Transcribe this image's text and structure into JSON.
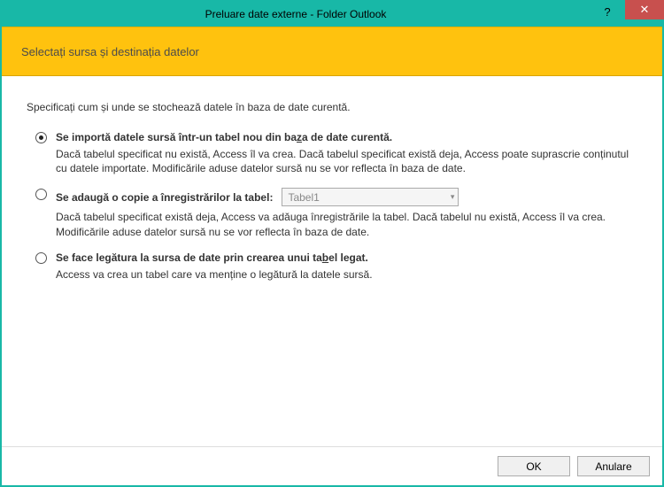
{
  "titlebar": {
    "title": "Preluare date externe - Folder Outlook",
    "help": "?",
    "close": "✕"
  },
  "banner": {
    "heading": "Selectați sursa și destinația datelor"
  },
  "instruction": "Specificați cum și unde se stochează datele în baza de date curentă.",
  "options": {
    "import": {
      "title_pre": "Se importă datele sursă într-un tabel nou din ba",
      "title_u": "z",
      "title_post": "a de date curentă.",
      "desc": "Dacă tabelul specificat nu există, Access îl va crea. Dacă tabelul specificat există deja, Access poate suprascrie conținutul cu datele importate. Modificările aduse datelor sursă nu se vor reflecta în baza de date."
    },
    "append": {
      "title_pre": "Se adau",
      "title_u": "g",
      "title_post": "ă o copie a înregistrărilor la tabel:",
      "combo_value": "Tabel1",
      "desc": "Dacă tabelul specificat există deja, Access va adăuga înregistrările la tabel. Dacă tabelul nu există, Access îl va crea. Modificările aduse datelor sursă nu se vor reflecta în baza de date."
    },
    "link": {
      "title_pre": "Se face legătura la sursa de date prin crearea unui ta",
      "title_u": "b",
      "title_post": "el legat.",
      "desc": "Access va crea un tabel care va menține o legătură la datele sursă."
    }
  },
  "footer": {
    "ok": "OK",
    "cancel": "Anulare"
  }
}
